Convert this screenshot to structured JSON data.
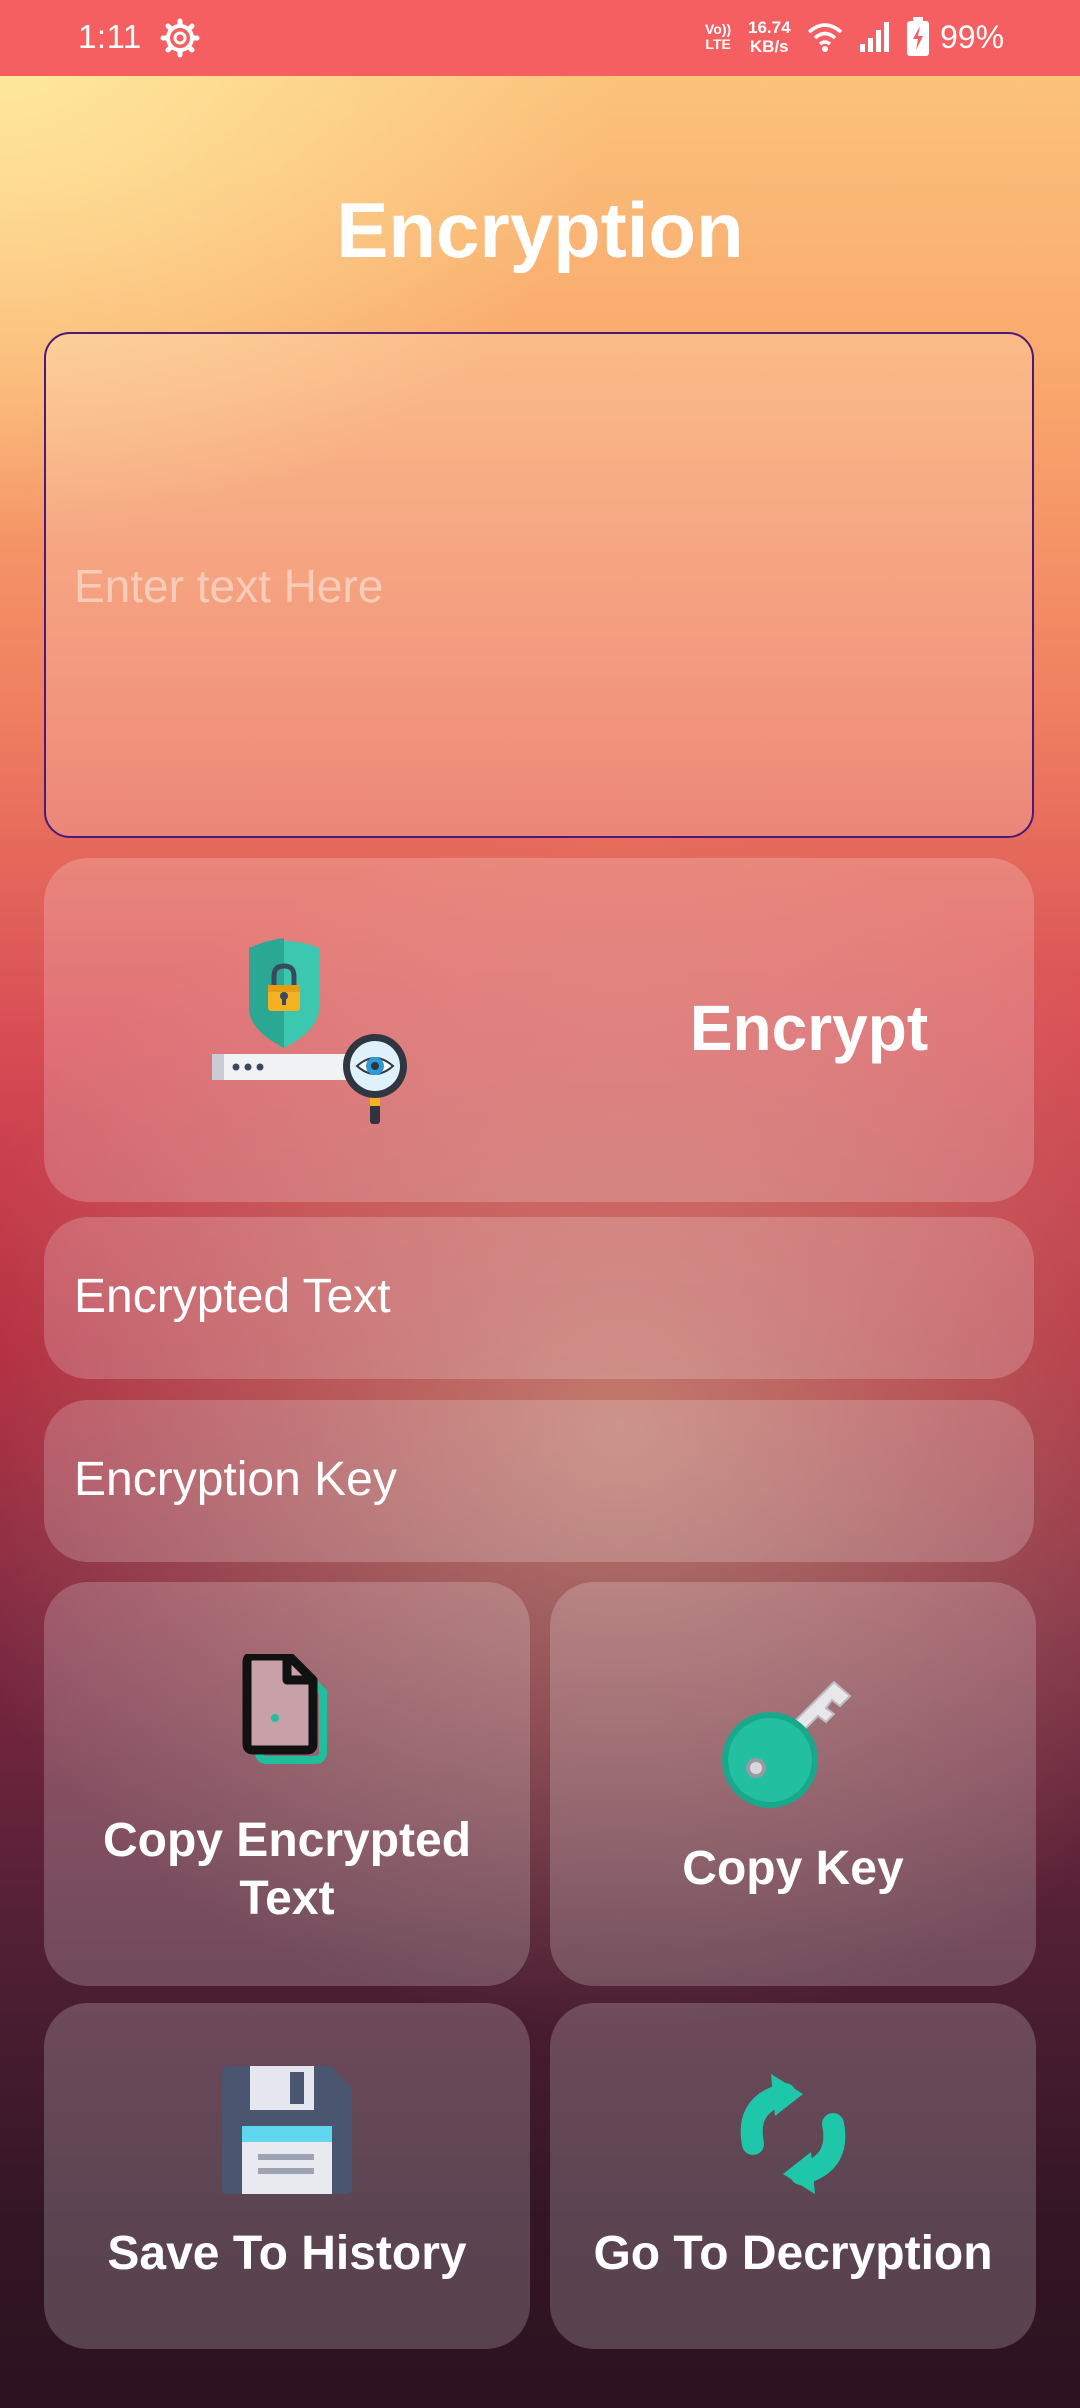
{
  "status_bar": {
    "time": "1:11",
    "volte_line1": "Vo))",
    "volte_line2": "LTE",
    "speed_value": "16.74",
    "speed_unit": "KB/s",
    "battery": "99%"
  },
  "page": {
    "title": "Encryption"
  },
  "input": {
    "placeholder": "Enter text Here",
    "value": ""
  },
  "encrypt_button": {
    "label": "Encrypt"
  },
  "fields": {
    "encrypted_text": "Encrypted Text",
    "encryption_key": "Encryption Key"
  },
  "actions": {
    "copy_encrypted_line1": "Copy Encrypted",
    "copy_encrypted_line2": "Text",
    "copy_key": "Copy Key",
    "save_history": "Save To History",
    "go_decryption": "Go To Decryption"
  },
  "colors": {
    "status_bar": "#f65f61",
    "accent_teal": "#1fbf9e",
    "input_border": "#4a1a78"
  },
  "icons": [
    "gear-icon",
    "wifi-icon",
    "signal-icon",
    "battery-icon",
    "shield-lock-icon",
    "document-icon",
    "key-icon",
    "floppy-disk-icon",
    "refresh-icon"
  ]
}
